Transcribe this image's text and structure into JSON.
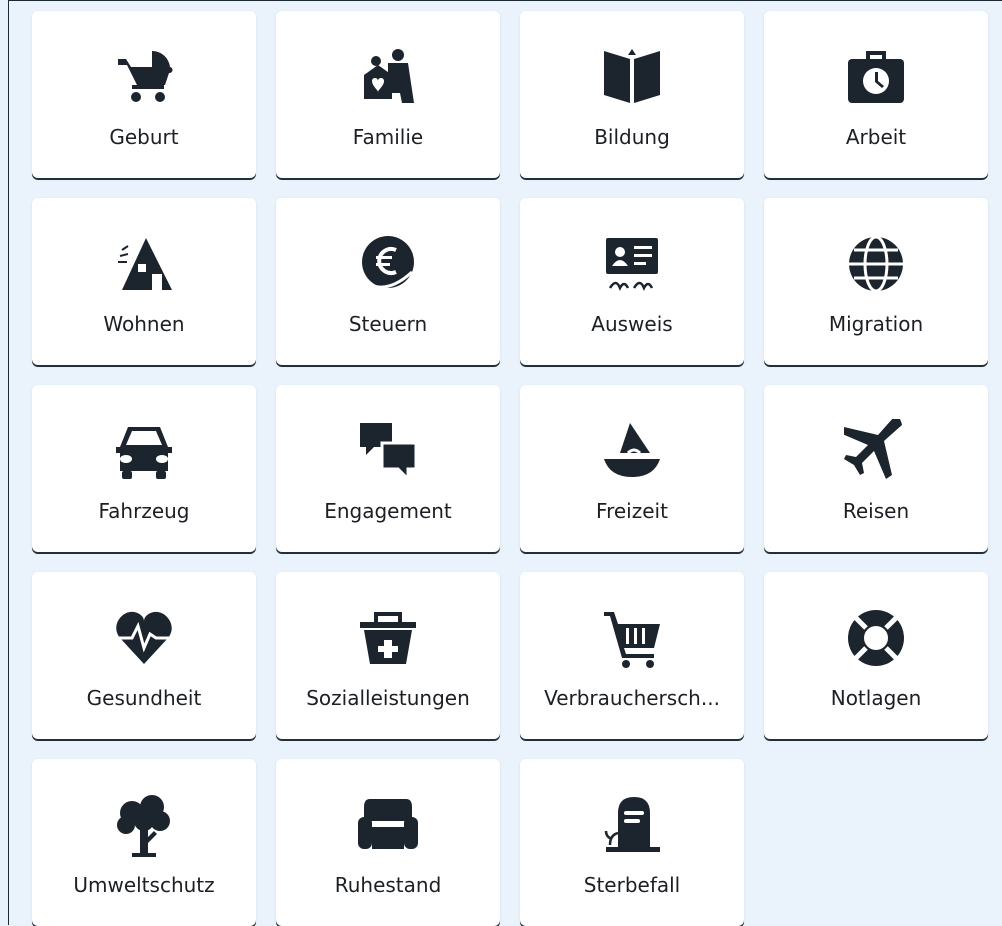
{
  "categories": [
    {
      "label": "Geburt",
      "icon": "stroller-icon"
    },
    {
      "label": "Familie",
      "icon": "family-icon"
    },
    {
      "label": "Bildung",
      "icon": "open-book-icon"
    },
    {
      "label": "Arbeit",
      "icon": "briefcase-clock-icon"
    },
    {
      "label": "Wohnen",
      "icon": "house-icon"
    },
    {
      "label": "Steuern",
      "icon": "euro-coin-icon"
    },
    {
      "label": "Ausweis",
      "icon": "id-card-icon"
    },
    {
      "label": "Migration",
      "icon": "globe-icon"
    },
    {
      "label": "Fahrzeug",
      "icon": "car-icon"
    },
    {
      "label": "Engagement",
      "icon": "speech-bubbles-icon"
    },
    {
      "label": "Freizeit",
      "icon": "sailboat-icon"
    },
    {
      "label": "Reisen",
      "icon": "airplane-icon"
    },
    {
      "label": "Gesundheit",
      "icon": "heart-pulse-icon"
    },
    {
      "label": "Sozialleistungen",
      "icon": "basket-plus-icon"
    },
    {
      "label": "Verbrauchersch...",
      "icon": "shopping-cart-icon"
    },
    {
      "label": "Notlagen",
      "icon": "lifebuoy-icon"
    },
    {
      "label": "Umweltschutz",
      "icon": "tree-icon"
    },
    {
      "label": "Ruhestand",
      "icon": "armchair-icon"
    },
    {
      "label": "Sterbefall",
      "icon": "gravestone-icon"
    }
  ]
}
